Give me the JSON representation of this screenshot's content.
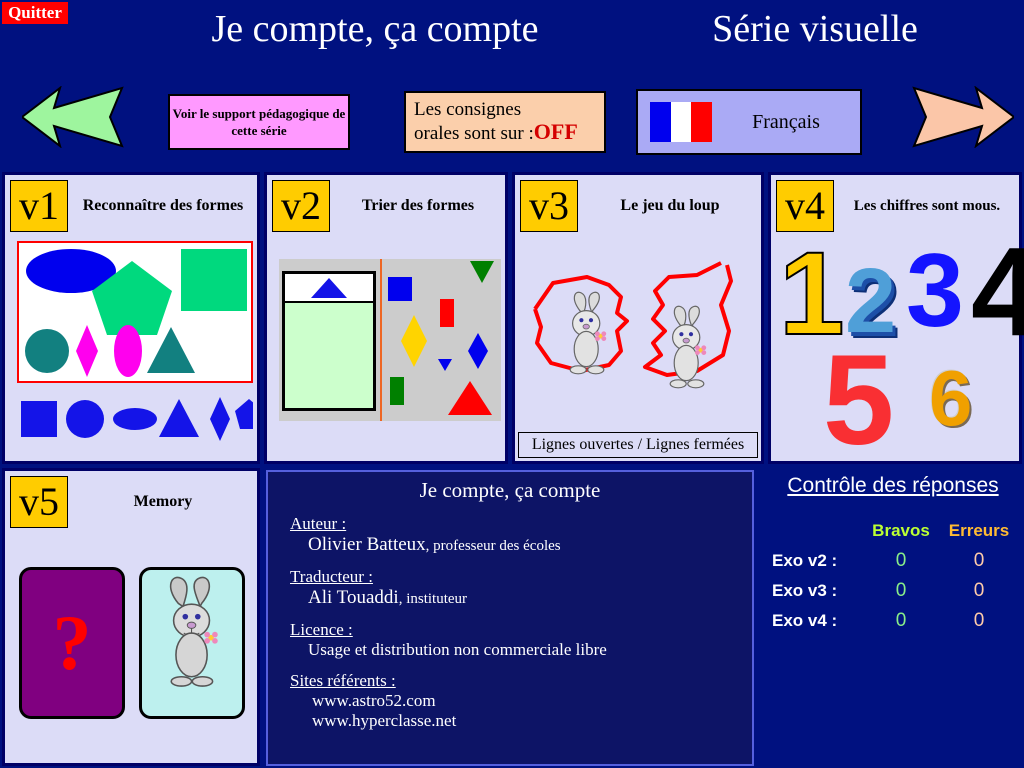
{
  "header": {
    "quit_label": "Quitter",
    "main_title": "Je compte, ça compte",
    "series_title": "Série visuelle"
  },
  "toolbar": {
    "prev_icon": "arrow-left-icon",
    "next_icon": "arrow-right-icon",
    "support_label": "Voir le support pédagogique de cette série",
    "consignes_line1": "Les consignes",
    "consignes_line2": "orales sont sur :",
    "consignes_state": "OFF",
    "language_label": "Français",
    "flag_icon": "french-flag-icon"
  },
  "exercises": [
    {
      "tag": "v1",
      "title": "Reconnaître des formes"
    },
    {
      "tag": "v2",
      "title": "Trier des formes"
    },
    {
      "tag": "v3",
      "title": "Le jeu du loup",
      "footer": "Lignes ouvertes / Lignes fermées"
    },
    {
      "tag": "v4",
      "title": "Les chiffres sont mous.",
      "digits": [
        "1",
        "2",
        "3",
        "4",
        "5",
        "6"
      ]
    },
    {
      "tag": "v5",
      "title": "Memory",
      "card_face": "?"
    }
  ],
  "credits": {
    "title": "Je compte, ça compte",
    "author_head": "Auteur :",
    "author_name": "Olivier Batteux",
    "author_role": ", professeur des écoles",
    "translator_head": "Traducteur :",
    "translator_name": "Ali Touaddi",
    "translator_role": ", instituteur",
    "licence_head": "Licence :",
    "licence_text": "Usage et distribution non commerciale libre",
    "sites_head": "Sites référents :",
    "site1": "www.astro52.com",
    "site2": "www.hyperclasse.net"
  },
  "scores": {
    "title": "Contrôle des réponses",
    "col_bravos": "Bravos",
    "col_erreurs": "Erreurs",
    "rows": [
      {
        "label": "Exo v2 :",
        "bravos": "0",
        "erreurs": "0"
      },
      {
        "label": "Exo v3 :",
        "bravos": "0",
        "erreurs": "0"
      },
      {
        "label": "Exo v4 :",
        "bravos": "0",
        "erreurs": "0"
      }
    ]
  },
  "colors": {
    "background": "#001180",
    "panel_fill": "#dcdcf7",
    "panel_border": "#000066",
    "tag_yellow": "#ffcc00",
    "quit_red": "#ff0000",
    "support_pink": "#ff99ff",
    "consignes_peach": "#fbcfab",
    "lang_violet": "#aaaaf5",
    "arrow_left_green": "#9ef59e",
    "arrow_right_peach": "#fbc6a8"
  }
}
